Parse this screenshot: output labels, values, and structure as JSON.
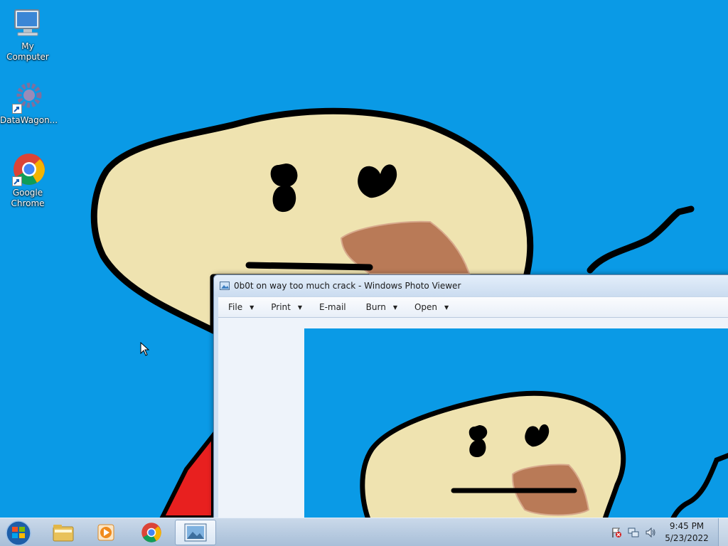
{
  "desktop": {
    "icons": [
      {
        "label": "My Computer"
      },
      {
        "label": "DataWagon..."
      },
      {
        "label": "Google Chrome"
      }
    ]
  },
  "viewer": {
    "title": "0b0t on way too much crack - Windows Photo Viewer",
    "menu": [
      {
        "label": "File",
        "dropdown": true
      },
      {
        "label": "Print",
        "dropdown": true
      },
      {
        "label": "E-mail",
        "dropdown": false
      },
      {
        "label": "Burn",
        "dropdown": true
      },
      {
        "label": "Open",
        "dropdown": true
      }
    ]
  },
  "taskbar": {
    "time": "9:45 PM",
    "date": "5/23/2022",
    "apps": [
      "start-orb-icon",
      "file-explorer-icon",
      "media-player-icon",
      "chrome-icon",
      "photo-viewer-icon"
    ]
  },
  "colors": {
    "wallpaper": "#0a9ae6",
    "face": "#efe3b0",
    "mouth": "#b97a57",
    "shirt": "#e8201f"
  }
}
